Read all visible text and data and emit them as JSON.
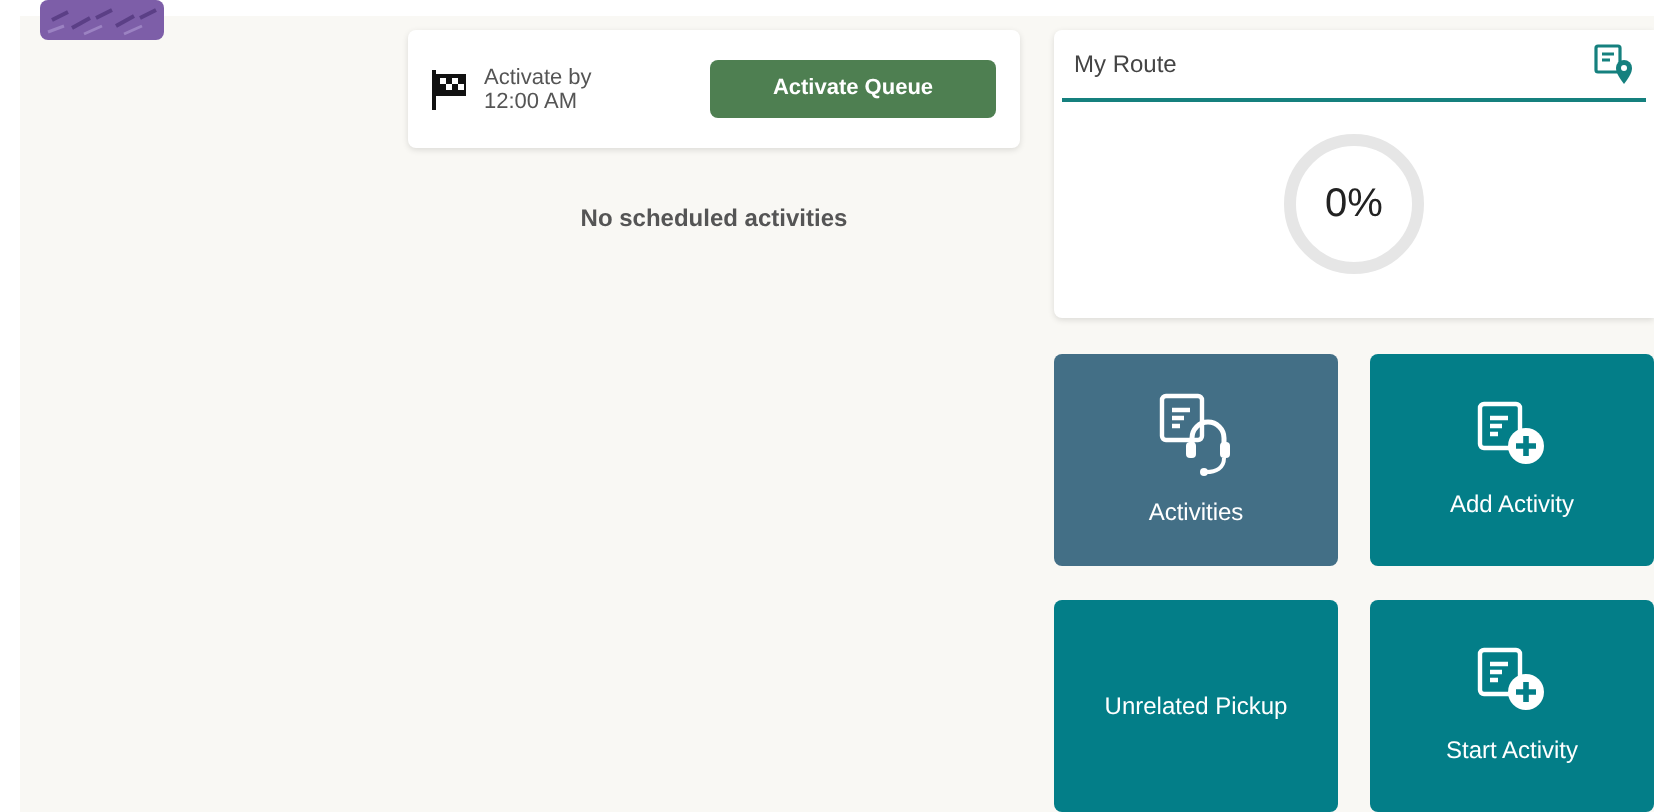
{
  "queue": {
    "activate_label": "Activate by",
    "activate_time": "12:00 AM",
    "button": "Activate Queue",
    "empty_message": "No scheduled activities"
  },
  "route": {
    "title": "My Route",
    "progress": "0%"
  },
  "tiles": [
    {
      "label": "Activities",
      "kind": "headset",
      "selected": true
    },
    {
      "label": "Add Activity",
      "kind": "add",
      "selected": false
    },
    {
      "label": "Unrelated Pickup",
      "kind": "none",
      "selected": false
    },
    {
      "label": "Start Activity",
      "kind": "add",
      "selected": false
    }
  ]
}
